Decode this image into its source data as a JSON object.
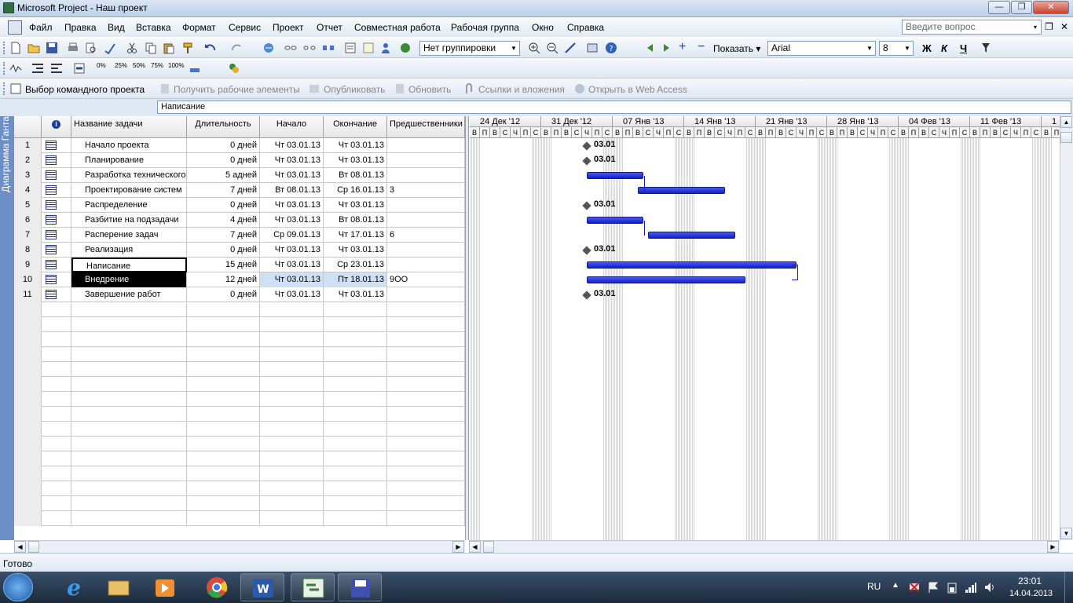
{
  "window": {
    "title": "Microsoft Project - Наш проект",
    "minimize": "—",
    "restore": "❐",
    "close": "✕"
  },
  "menu": {
    "items": [
      "Файл",
      "Правка",
      "Вид",
      "Вставка",
      "Формат",
      "Сервис",
      "Проект",
      "Отчет",
      "Совместная работа",
      "Рабочая группа",
      "Окно",
      "Справка"
    ],
    "help_placeholder": "Введите вопрос",
    "help_arrow": "▾",
    "doc_restore": "❐",
    "doc_close": "✕"
  },
  "toolbar1": {
    "grouping": "Нет группировки",
    "show": "Показать",
    "font": "Arial",
    "size": "8",
    "bold": "Ж",
    "italic": "К",
    "underline": "Ч"
  },
  "toolbar2": {
    "percents": [
      "0%",
      "25%",
      "50%",
      "75%",
      "100%"
    ]
  },
  "toolbar3": {
    "items": [
      "Выбор командного проекта",
      "Получить рабочие элементы",
      "Опубликовать",
      "Обновить",
      "Ссылки и вложения",
      "Открыть в Web Access"
    ]
  },
  "entry_bar": {
    "value": "Написание"
  },
  "side_view": {
    "label": "Диаграмма Ганта"
  },
  "table": {
    "columns": {
      "info": "i",
      "name": "Название задачи",
      "duration": "Длительность",
      "start": "Начало",
      "finish": "Окончание",
      "pred": "Предшественники"
    },
    "rows": [
      {
        "id": "1",
        "name": "Начало проекта",
        "duration": "0 дней",
        "start": "Чт 03.01.13",
        "finish": "Чт 03.01.13",
        "pred": ""
      },
      {
        "id": "2",
        "name": "Планирование",
        "duration": "0 дней",
        "start": "Чт 03.01.13",
        "finish": "Чт 03.01.13",
        "pred": ""
      },
      {
        "id": "3",
        "name": "Разработка технического",
        "duration": "5 адней",
        "start": "Чт 03.01.13",
        "finish": "Вт 08.01.13",
        "pred": ""
      },
      {
        "id": "4",
        "name": "Проектирование систем",
        "duration": "7 дней",
        "start": "Вт 08.01.13",
        "finish": "Ср 16.01.13",
        "pred": "3"
      },
      {
        "id": "5",
        "name": "Распределение",
        "duration": "0 дней",
        "start": "Чт 03.01.13",
        "finish": "Чт 03.01.13",
        "pred": ""
      },
      {
        "id": "6",
        "name": "Разбитие на подзадачи",
        "duration": "4 дней",
        "start": "Чт 03.01.13",
        "finish": "Вт 08.01.13",
        "pred": ""
      },
      {
        "id": "7",
        "name": "Расперение задач",
        "duration": "7 дней",
        "start": "Ср 09.01.13",
        "finish": "Чт 17.01.13",
        "pred": "6"
      },
      {
        "id": "8",
        "name": "Реализация",
        "duration": "0 дней",
        "start": "Чт 03.01.13",
        "finish": "Чт 03.01.13",
        "pred": ""
      },
      {
        "id": "9",
        "name": "Написание",
        "duration": "15 дней",
        "start": "Чт 03.01.13",
        "finish": "Ср 23.01.13",
        "pred": ""
      },
      {
        "id": "10",
        "name": "Внедрение",
        "duration": "12 дней",
        "start": "Чт 03.01.13",
        "finish": "Пт 18.01.13",
        "pred": "9ОО"
      },
      {
        "id": "11",
        "name": "Завершение работ",
        "duration": "0 дней",
        "start": "Чт 03.01.13",
        "finish": "Чт 03.01.13",
        "pred": ""
      }
    ]
  },
  "timescale": {
    "weeks": [
      "24 Дек '12",
      "31 Дек '12",
      "07 Янв '13",
      "14 Янв '13",
      "21 Янв '13",
      "28 Янв '13",
      "04 Фев '13",
      "11 Фев '13",
      "1"
    ],
    "days": [
      "В",
      "П",
      "В",
      "С",
      "Ч",
      "П",
      "С"
    ]
  },
  "gantt": {
    "milestone_label": "03.01"
  },
  "status": {
    "text": "Готово"
  },
  "taskbar": {
    "lang": "RU",
    "time": "23:01",
    "date": "14.04.2013"
  },
  "colors": {
    "bar": "#1a2ae0",
    "side": "#6d8fc8",
    "selected_row": "#000000"
  }
}
